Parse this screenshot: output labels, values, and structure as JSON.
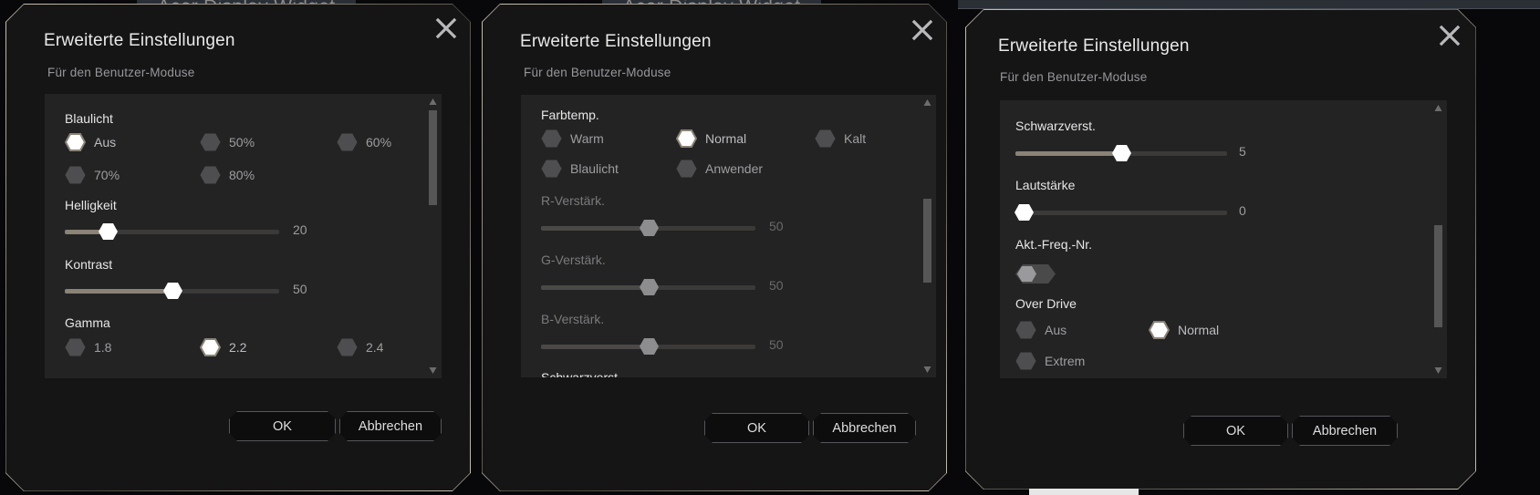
{
  "app": {
    "window_title": "Acer Display Widget"
  },
  "dialogs": [
    {
      "id": "dialog-blue-light",
      "title": "Erweiterte Einstellungen",
      "subtitle": "Für den Benutzer-Moduse",
      "close_icon": "close-icon",
      "groups": [
        {
          "type": "radio-group",
          "label": "Blaulicht",
          "options": [
            {
              "label": "Aus",
              "selected": true,
              "dim": false
            },
            {
              "label": "50%",
              "selected": false,
              "dim": false
            },
            {
              "label": "60%",
              "selected": false,
              "dim": false
            },
            {
              "label": "70%",
              "selected": false,
              "dim": false
            },
            {
              "label": "80%",
              "selected": false,
              "dim": false
            }
          ]
        },
        {
          "type": "slider",
          "label": "Helligkeit",
          "value": "20",
          "percent": 20,
          "dim": false
        },
        {
          "type": "slider",
          "label": "Kontrast",
          "value": "50",
          "percent": 50,
          "dim": false
        },
        {
          "type": "radio-group",
          "label": "Gamma",
          "options": [
            {
              "label": "1.8",
              "selected": false,
              "dim": false
            },
            {
              "label": "2.2",
              "selected": true,
              "dim": false
            },
            {
              "label": "2.4",
              "selected": false,
              "dim": false
            }
          ]
        }
      ],
      "scrollbar": {
        "thumb_top_pct": 8,
        "thumb_height_pct": 34
      },
      "buttons": {
        "ok": "OK",
        "cancel": "Abbrechen"
      }
    },
    {
      "id": "dialog-color-temp",
      "title": "Erweiterte Einstellungen",
      "subtitle": "Für den Benutzer-Moduse",
      "close_icon": "close-icon",
      "groups": [
        {
          "type": "radio-group",
          "label": "Farbtemp.",
          "options": [
            {
              "label": "Warm",
              "selected": false,
              "dim": false
            },
            {
              "label": "Normal",
              "selected": true,
              "dim": false
            },
            {
              "label": "Kalt",
              "selected": false,
              "dim": false
            },
            {
              "label": "Blaulicht",
              "selected": false,
              "dim": false
            },
            {
              "label": "Anwender",
              "selected": false,
              "dim": false
            }
          ]
        },
        {
          "type": "slider",
          "label": "R-Verstärk.",
          "value": "50",
          "percent": 50,
          "dim": true
        },
        {
          "type": "slider",
          "label": "G-Verstärk.",
          "value": "50",
          "percent": 50,
          "dim": true
        },
        {
          "type": "slider",
          "label": "B-Verstärk.",
          "value": "50",
          "percent": 50,
          "dim": true
        },
        {
          "type": "cut-label",
          "label": "Schwarzverst."
        }
      ],
      "scrollbar": {
        "thumb_top_pct": 38,
        "thumb_height_pct": 30
      },
      "buttons": {
        "ok": "OK",
        "cancel": "Abbrechen"
      }
    },
    {
      "id": "dialog-black-boost",
      "title": "Erweiterte Einstellungen",
      "subtitle": "Für den Benutzer-Moduse",
      "close_icon": "close-icon",
      "groups": [
        {
          "type": "slider",
          "label": "Schwarzverst.",
          "value": "5",
          "percent": 50,
          "dim": false
        },
        {
          "type": "slider",
          "label": "Lautstärke",
          "value": "0",
          "percent": 0,
          "dim": false
        },
        {
          "type": "toggle",
          "label": "Akt.-Freq.-Nr.",
          "on": false
        },
        {
          "type": "radio-group",
          "label": "Over Drive",
          "options": [
            {
              "label": "Aus",
              "selected": false,
              "dim": false
            },
            {
              "label": "Normal",
              "selected": true,
              "dim": false
            },
            {
              "label": "Extrem",
              "selected": false,
              "dim": false
            }
          ]
        }
      ],
      "scrollbar": {
        "thumb_top_pct": 44,
        "thumb_height_pct": 38
      },
      "buttons": {
        "ok": "OK",
        "cancel": "Abbrechen"
      }
    }
  ],
  "colors": {
    "panel_bg": "#151516",
    "content_bg": "#232324",
    "accent": "#8a8376",
    "border": "#c9c2b2",
    "text": "#e9e9ea",
    "text_dim": "#7a7a7c"
  }
}
